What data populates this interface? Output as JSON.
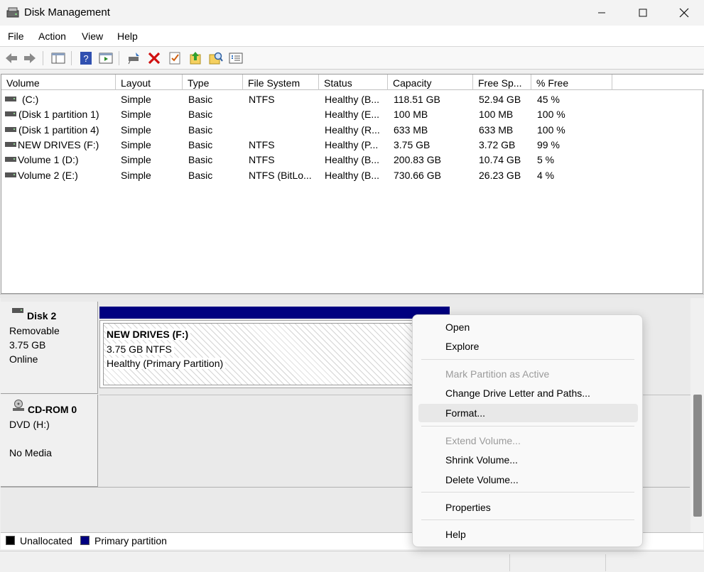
{
  "window": {
    "title": "Disk Management"
  },
  "menu": {
    "items": [
      "File",
      "Action",
      "View",
      "Help"
    ]
  },
  "volume_list": {
    "columns": [
      "Volume",
      "Layout",
      "Type",
      "File System",
      "Status",
      "Capacity",
      "Free Sp...",
      "% Free"
    ],
    "rows": [
      [
        "(C:)",
        "Simple",
        "Basic",
        "NTFS",
        "Healthy (B...",
        "118.51 GB",
        "52.94 GB",
        "45 %"
      ],
      [
        "(Disk 1 partition 1)",
        "Simple",
        "Basic",
        "",
        "Healthy (E...",
        "100 MB",
        "100 MB",
        "100 %"
      ],
      [
        "(Disk 1 partition 4)",
        "Simple",
        "Basic",
        "",
        "Healthy (R...",
        "633 MB",
        "633 MB",
        "100 %"
      ],
      [
        "NEW DRIVES (F:)",
        "Simple",
        "Basic",
        "NTFS",
        "Healthy (P...",
        "3.75 GB",
        "3.72 GB",
        "99 %"
      ],
      [
        "Volume 1 (D:)",
        "Simple",
        "Basic",
        "NTFS",
        "Healthy (B...",
        "200.83 GB",
        "10.74 GB",
        "5 %"
      ],
      [
        "Volume 2 (E:)",
        "Simple",
        "Basic",
        "NTFS (BitLo...",
        "Healthy (B...",
        "730.66 GB",
        "26.23 GB",
        "4 %"
      ]
    ]
  },
  "disk2": {
    "name": "Disk 2",
    "kind": "Removable",
    "size": "3.75 GB",
    "state": "Online",
    "partition": {
      "name": "NEW DRIVES  (F:)",
      "size_fs": "3.75 GB NTFS",
      "status": "Healthy (Primary Partition)"
    }
  },
  "cdrom0": {
    "name": "CD-ROM 0",
    "kind": "DVD (H:)",
    "state": "No Media"
  },
  "legend": {
    "unallocated": "Unallocated",
    "primary": "Primary partition",
    "unallocated_color": "#000000",
    "primary_color": "#000080"
  },
  "context_menu": {
    "open": "Open",
    "explore": "Explore",
    "mark_active": "Mark Partition as Active",
    "change_letter": "Change Drive Letter and Paths...",
    "format": "Format...",
    "extend": "Extend Volume...",
    "shrink": "Shrink Volume...",
    "delete": "Delete Volume...",
    "properties": "Properties",
    "help": "Help"
  },
  "toolbar_icons": [
    "back-icon",
    "forward-icon",
    "console-tree-icon",
    "help-icon",
    "action-pane-icon",
    "connect-disk-icon",
    "delete-icon",
    "check-icon",
    "rescan-icon",
    "search-icon",
    "properties-icon"
  ]
}
